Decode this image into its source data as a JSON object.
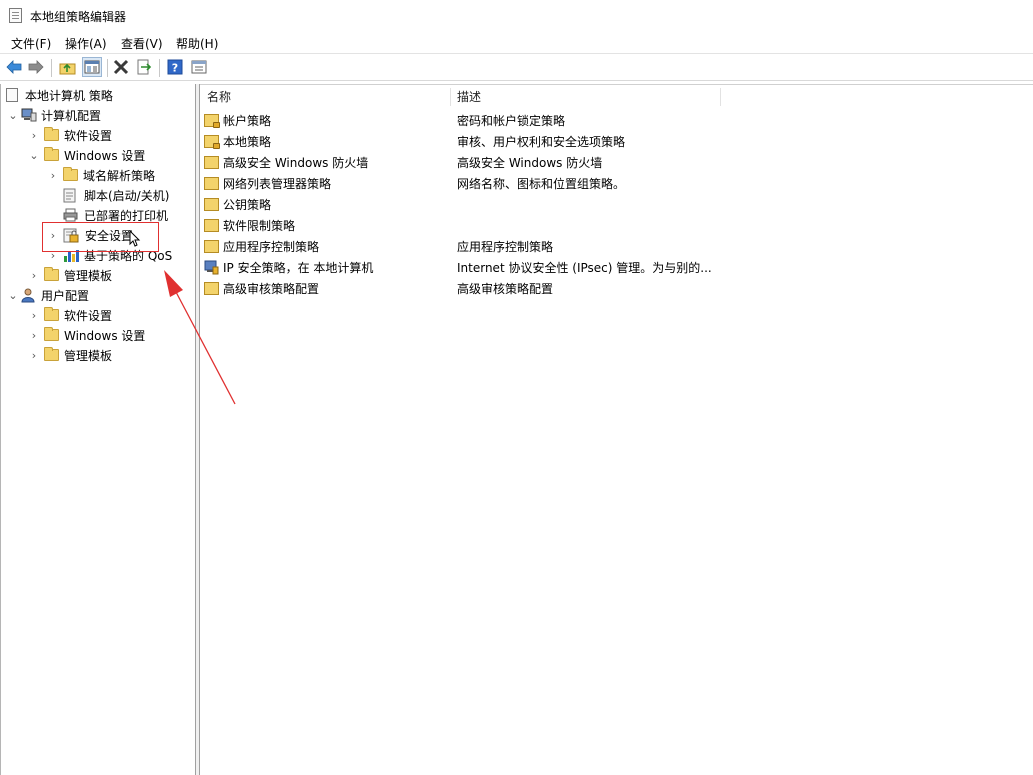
{
  "window": {
    "title": "本地组策略编辑器"
  },
  "menubar": {
    "items": [
      "文件(F)",
      "操作(A)",
      "查看(V)",
      "帮助(H)"
    ]
  },
  "tree": {
    "root": "本地计算机 策略",
    "computer_config": "计算机配置",
    "software_settings": "软件设置",
    "windows_settings": "Windows 设置",
    "dns_policy": "域名解析策略",
    "scripts": "脚本(启动/关机)",
    "printers": "已部署的打印机",
    "security_settings": "安全设置",
    "qos": "基于策略的 QoS",
    "admin_templates": "管理模板",
    "user_config": "用户配置",
    "user_software_settings": "软件设置",
    "user_windows_settings": "Windows 设置",
    "user_admin_templates": "管理模板"
  },
  "list": {
    "headers": {
      "name": "名称",
      "description": "描述"
    },
    "rows": [
      {
        "name": "帐户策略",
        "description": "密码和帐户锁定策略"
      },
      {
        "name": "本地策略",
        "description": "审核、用户权利和安全选项策略"
      },
      {
        "name": "高级安全 Windows 防火墙",
        "description": "高级安全 Windows 防火墙"
      },
      {
        "name": "网络列表管理器策略",
        "description": "网络名称、图标和位置组策略。"
      },
      {
        "name": "公钥策略",
        "description": ""
      },
      {
        "name": "软件限制策略",
        "description": ""
      },
      {
        "name": "应用程序控制策略",
        "description": "应用程序控制策略"
      },
      {
        "name": "IP 安全策略，在 本地计算机",
        "description": "Internet 协议安全性 (IPsec) 管理。为与别的..."
      },
      {
        "name": "高级审核策略配置",
        "description": "高级审核策略配置"
      }
    ]
  },
  "icons": {
    "back": "back-arrow-icon",
    "forward": "forward-arrow-icon",
    "up": "up-folder-icon",
    "show_tree": "show-hide-tree-icon",
    "delete": "delete-icon",
    "export": "export-list-icon",
    "help": "help-icon",
    "properties": "properties-icon"
  },
  "colors": {
    "annotation": "#e03030",
    "folder": "#f3d36b",
    "toolbar_arrow": "#3b8ad9"
  }
}
